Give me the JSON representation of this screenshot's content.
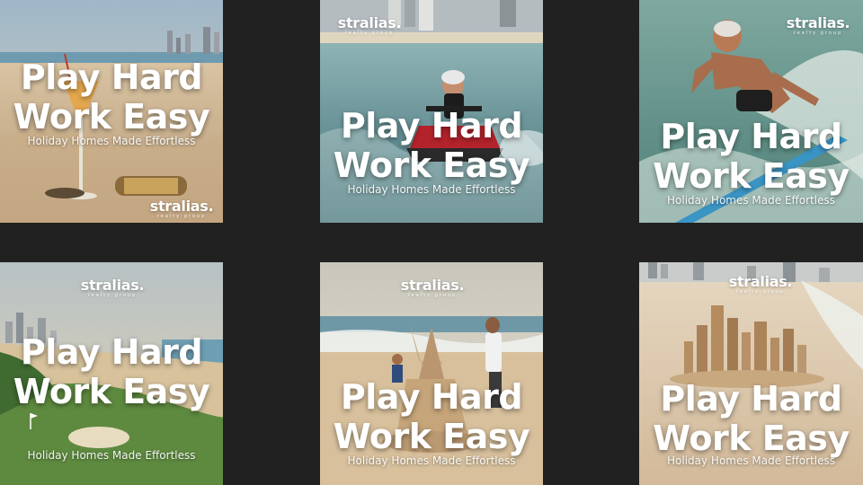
{
  "tiles": [
    {
      "headline_line1": "Play Hard",
      "headline_line2": "Work Easy",
      "tagline": "Holiday Homes Made Effortless",
      "logo_brand": "stralias.",
      "logo_sub": "realty group",
      "scene": "beach cocktail with sunglasses"
    },
    {
      "headline_line1": "Play Hard",
      "headline_line2": "Work Easy",
      "tagline": "Holiday Homes Made Effortless",
      "logo_brand": "stralias.",
      "logo_sub": "realty group",
      "scene": "elderly woman on jet ski"
    },
    {
      "headline_line1": "Play Hard",
      "headline_line2": "Work Easy",
      "tagline": "Holiday Homes Made Effortless",
      "logo_brand": "stralias.",
      "logo_sub": "realty group",
      "scene": "elderly man surfing"
    },
    {
      "headline_line1": "Play Hard",
      "headline_line2": "Work Easy",
      "tagline": "Holiday Homes Made Effortless",
      "logo_brand": "stralias.",
      "logo_sub": "realty group",
      "scene": "coastal golf course with city skyline"
    },
    {
      "headline_line1": "Play Hard",
      "headline_line2": "Work Easy",
      "tagline": "Holiday Homes Made Effortless",
      "logo_brand": "stralias.",
      "logo_sub": "realty group",
      "scene": "father and child building sandcastle"
    },
    {
      "headline_line1": "Play Hard",
      "headline_line2": "Work Easy",
      "tagline": "Holiday Homes Made Effortless",
      "logo_brand": "stralias.",
      "logo_sub": "realty group",
      "scene": "sand sculpture of city skyline"
    }
  ],
  "colors": {
    "background": "#212121",
    "text": "#ffffff"
  }
}
